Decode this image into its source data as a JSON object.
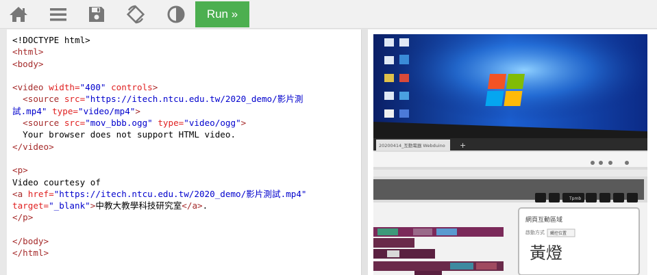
{
  "toolbar": {
    "icons": [
      "home-icon",
      "menu-icon",
      "save-icon",
      "rotate-icon",
      "contrast-icon"
    ],
    "run_label": "Run »",
    "colors": {
      "run_bg": "#4caf50",
      "icon": "#777777"
    }
  },
  "editor": {
    "lines": [
      [
        {
          "t": "txt",
          "s": "<!DOCTYPE html>"
        }
      ],
      [
        {
          "t": "tag",
          "s": "<html>"
        }
      ],
      [
        {
          "t": "tag",
          "s": "<body>"
        }
      ],
      [],
      [
        {
          "t": "tag",
          "s": "<video "
        },
        {
          "t": "attr",
          "s": "width="
        },
        {
          "t": "val",
          "s": "\"400\""
        },
        {
          "t": "attr",
          "s": " controls"
        },
        {
          "t": "tag",
          "s": ">"
        }
      ],
      [
        {
          "t": "txt",
          "s": "  "
        },
        {
          "t": "tag",
          "s": "<source "
        },
        {
          "t": "attr",
          "s": "src="
        },
        {
          "t": "val",
          "s": "\"https://itech.ntcu.edu.tw/2020_demo/影片測"
        }
      ],
      [
        {
          "t": "val",
          "s": "試.mp4\""
        },
        {
          "t": "attr",
          "s": " type="
        },
        {
          "t": "val",
          "s": "\"video/mp4\""
        },
        {
          "t": "tag",
          "s": ">"
        }
      ],
      [
        {
          "t": "txt",
          "s": "  "
        },
        {
          "t": "tag",
          "s": "<source "
        },
        {
          "t": "attr",
          "s": "src="
        },
        {
          "t": "val",
          "s": "\"mov_bbb.ogg\""
        },
        {
          "t": "attr",
          "s": " type="
        },
        {
          "t": "val",
          "s": "\"video/ogg\""
        },
        {
          "t": "tag",
          "s": ">"
        }
      ],
      [
        {
          "t": "txt",
          "s": "  Your browser does not support HTML video."
        }
      ],
      [
        {
          "t": "tag",
          "s": "</video>"
        }
      ],
      [],
      [
        {
          "t": "tag",
          "s": "<p>"
        }
      ],
      [
        {
          "t": "txt",
          "s": "Video courtesy of"
        }
      ],
      [
        {
          "t": "tag",
          "s": "<a "
        },
        {
          "t": "attr",
          "s": "href="
        },
        {
          "t": "val",
          "s": "\"https://itech.ntcu.edu.tw/2020_demo/影片測試.mp4\""
        }
      ],
      [
        {
          "t": "attr",
          "s": "target="
        },
        {
          "t": "val",
          "s": "\"_blank\""
        },
        {
          "t": "tag",
          "s": ">"
        },
        {
          "t": "txt",
          "s": "中教大教學科技研究室"
        },
        {
          "t": "tag",
          "s": "</a>"
        },
        {
          "t": "txt",
          "s": "."
        }
      ],
      [
        {
          "t": "tag",
          "s": "</p>"
        }
      ],
      [],
      [
        {
          "t": "tag",
          "s": "</body>"
        }
      ],
      [
        {
          "t": "tag",
          "s": "</html>"
        }
      ]
    ]
  },
  "preview": {
    "video": {
      "tab_title": "20200414_互動電器  Webduino",
      "tab_new": "+",
      "panel_title": "網頁互動區域",
      "panel_sub": "啟動方式",
      "panel_select": "觸控位置",
      "panel_big": "黃燈",
      "toolbar_label": "Tpmb"
    }
  }
}
